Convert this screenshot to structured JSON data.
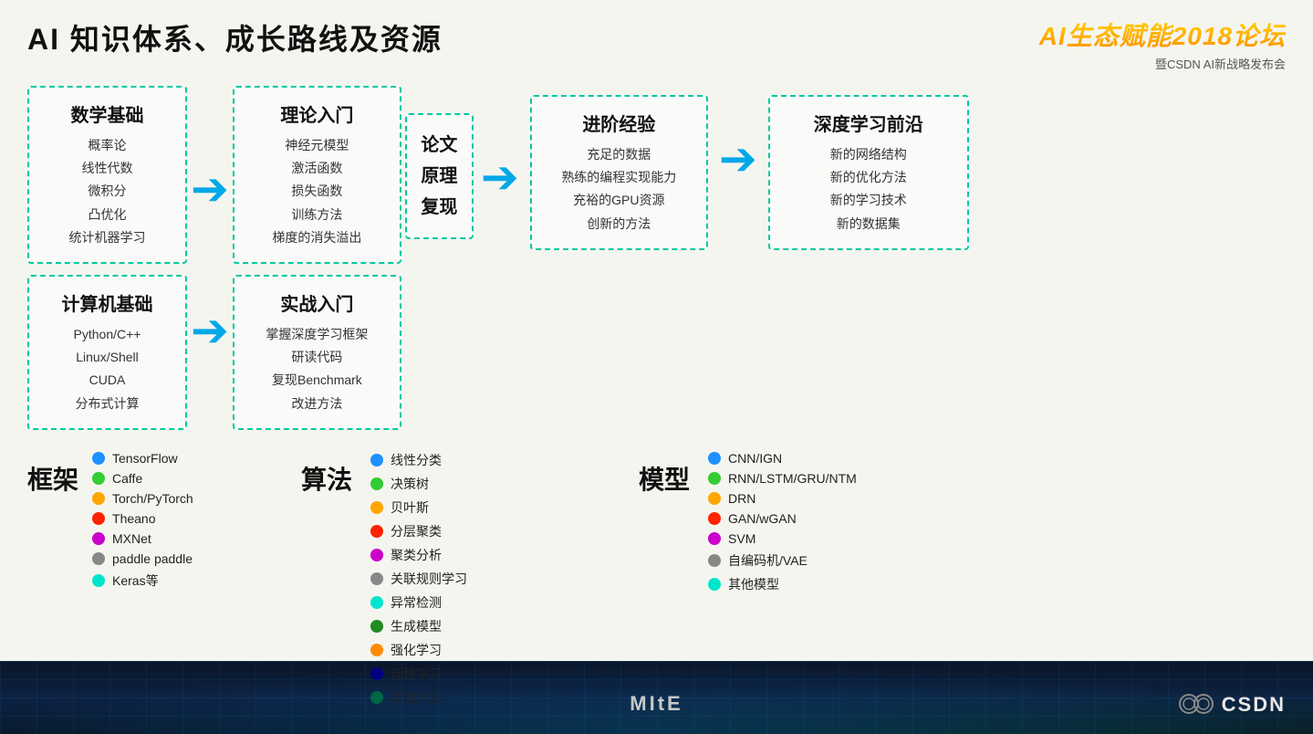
{
  "header": {
    "main_title": "AI 知识体系、成长路线及资源",
    "brand_title": "AI生态赋能2018论坛",
    "brand_subtitle": "暨CSDN AI新战略发布会"
  },
  "diagram": {
    "col1": {
      "math_title": "数学基础",
      "math_items": [
        "概率论",
        "线性代数",
        "微积分",
        "凸优化",
        "统计机器学习"
      ],
      "cs_title": "计算机基础",
      "cs_items": [
        "Python/C++",
        "Linux/Shell",
        "CUDA",
        "分布式计算"
      ]
    },
    "col2": {
      "theory_title": "理论入门",
      "theory_items": [
        "神经元模型",
        "激活函数",
        "损失函数",
        "训练方法",
        "梯度的消失溢出"
      ],
      "practice_title": "实战入门",
      "practice_items": [
        "掌握深度学习框架",
        "研读代码",
        "复现Benchmark",
        "改进方法"
      ]
    },
    "col3": {
      "paper_lines": [
        "论文",
        "原理",
        "复现"
      ]
    },
    "col4": {
      "title": "进阶经验",
      "items": [
        "充足的数据",
        "熟练的编程实现能力",
        "充裕的GPU资源",
        "创新的方法"
      ]
    },
    "col5": {
      "title": "深度学习前沿",
      "items": [
        "新的网络结构",
        "新的优化方法",
        "新的学习技术",
        "新的数据集"
      ]
    }
  },
  "framework": {
    "label": "框架",
    "items": [
      {
        "color": "#1e90ff",
        "name": "TensorFlow"
      },
      {
        "color": "#32cd32",
        "name": "Caffe"
      },
      {
        "color": "#ffa500",
        "name": "Torch/PyTorch"
      },
      {
        "color": "#ff2200",
        "name": "Theano"
      },
      {
        "color": "#cc00cc",
        "name": "MXNet"
      },
      {
        "color": "#888888",
        "name": "paddle paddle"
      },
      {
        "color": "#00e5cc",
        "name": "Keras等"
      }
    ]
  },
  "algorithm": {
    "label": "算法",
    "items": [
      {
        "color": "#1e90ff",
        "name": "线性分类"
      },
      {
        "color": "#32cd32",
        "name": "决策树"
      },
      {
        "color": "#ffa500",
        "name": "贝叶斯"
      },
      {
        "color": "#ff2200",
        "name": "分层聚类"
      },
      {
        "color": "#cc00cc",
        "name": "聚类分析"
      },
      {
        "color": "#888888",
        "name": "关联规则学习"
      },
      {
        "color": "#00e5cc",
        "name": "异常检测"
      },
      {
        "color": "#228b22",
        "name": "生成模型"
      },
      {
        "color": "#ff8c00",
        "name": "强化学习"
      },
      {
        "color": "#000080",
        "name": "迁移学习"
      },
      {
        "color": "#006644",
        "name": "其他方法"
      }
    ]
  },
  "model": {
    "label": "模型",
    "items": [
      {
        "color": "#1e90ff",
        "name": "CNN/IGN"
      },
      {
        "color": "#32cd32",
        "name": "RNN/LSTM/GRU/NTM"
      },
      {
        "color": "#ffa500",
        "name": "DRN"
      },
      {
        "color": "#ff2200",
        "name": "GAN/wGAN"
      },
      {
        "color": "#cc00cc",
        "name": "SVM"
      },
      {
        "color": "#888888",
        "name": "自编码机/VAE"
      },
      {
        "color": "#00e5cc",
        "name": "其他模型"
      }
    ]
  },
  "mite": "MItE",
  "csdn": "CSDN"
}
